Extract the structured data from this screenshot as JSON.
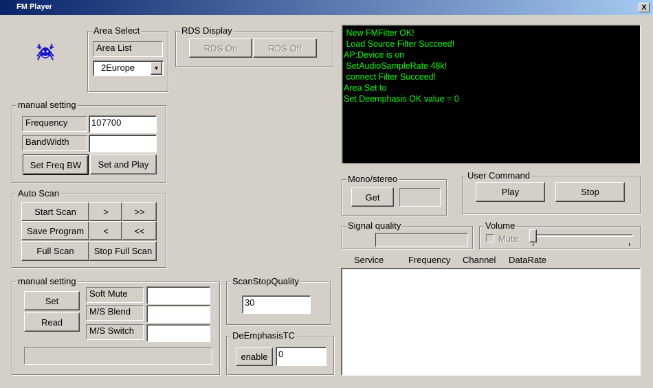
{
  "window": {
    "title": "FM Player",
    "close_label": "X"
  },
  "area_select": {
    "label": "Area Select",
    "list_label": "Area List",
    "selected": "2Europe",
    "dropdown_arrow": "▼"
  },
  "rds": {
    "label": "RDS Display",
    "on": "RDS On",
    "off": "RDS Off"
  },
  "console": {
    "lines": [
      " New FMFilter OK!",
      " Load Source Filter Succeed!",
      "AP:Device is on",
      " SetAudioSampleRate 48k!",
      " connect Filter Succeed!",
      "Area Set to",
      "Set Deemphasis OK value = 0"
    ]
  },
  "manual1": {
    "label": "manual setting",
    "freq_label": "Frequency",
    "freq_value": "107700",
    "bw_label": "BandWidth",
    "bw_value": "",
    "set_freq_bw": "Set Freq BW",
    "set_and_play": "Set and Play"
  },
  "auto_scan": {
    "label": "Auto Scan",
    "start_scan": "Start Scan",
    "next": ">",
    "fast_next": ">>",
    "save_program": "Save Program",
    "prev": "<",
    "fast_prev": "<<",
    "full_scan": "Full Scan",
    "stop_full_scan": "Stop Full Scan"
  },
  "manual2": {
    "label": "manual setting",
    "set": "Set",
    "read": "Read",
    "soft_mute": "Soft Mute",
    "ms_blend": "M/S Blend",
    "ms_switch": "M/S Switch"
  },
  "scan_stop": {
    "label": "ScanStopQuality",
    "value": "30"
  },
  "deemphasis": {
    "label": "DeEmphasisTC",
    "enable": "enable",
    "value": "0"
  },
  "mono_stereo": {
    "label": "Mono/stereo",
    "get": "Get"
  },
  "user_command": {
    "label": "User Command",
    "play": "Play",
    "stop": "Stop"
  },
  "signal_quality": {
    "label": "Signal quality"
  },
  "volume": {
    "label": "Volume",
    "mute": "Mute",
    "level": 0
  },
  "stations_table": {
    "headers": [
      "Service",
      "Frequency",
      "Channel",
      "DataRate"
    ]
  },
  "colors": {
    "console_bg": "#000000",
    "console_text": "#00ff00",
    "dialog_bg": "#d4d0c8",
    "title_start": "#0a246a"
  },
  "icons": {
    "app_logo": "realtek-crab-icon"
  }
}
